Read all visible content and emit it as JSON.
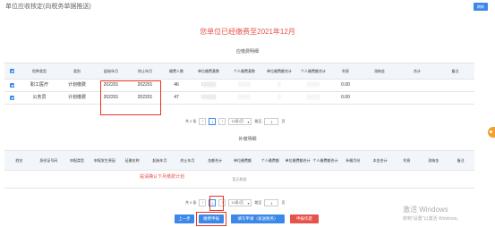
{
  "header": {
    "title": "单位应收核定(向税务单据推送)",
    "action_button": "刷新"
  },
  "banner": {
    "text": "您单位已经缴费至2021年12月"
  },
  "main_table": {
    "section_title": "应缴费明细",
    "columns": [
      "",
      "险种类型",
      "类别",
      "起始年月",
      "终止年月",
      "缴费人数",
      "单位缴费基数",
      "个人缴费基数",
      "单位缴费额合计",
      "个人缴费额合计",
      "利息",
      "滞纳金",
      "合计",
      "备注"
    ],
    "rows": [
      {
        "checked": true,
        "cells": [
          "职工医疗",
          "计划缴费",
          "202201",
          "202201",
          "46",
          "1▒▒▒▒",
          "▒▒▒▒",
          "▒",
          "▒▒▒▒",
          "0.00",
          "",
          "",
          ""
        ]
      },
      {
        "checked": true,
        "cells": [
          "公务员",
          "计划缴费",
          "202201",
          "202201",
          "47",
          "1▒▒▒▒",
          "▒▒▒▒",
          "▒",
          "▒▒▒▒",
          "0.00",
          "",
          "",
          ""
        ]
      }
    ]
  },
  "pager1": {
    "total": "共 2 条",
    "page": "1",
    "page_size": "10条/页",
    "goto_label": "跳至",
    "goto_value": "1",
    "page_unit": "页",
    "prev": "‹",
    "next": "›"
  },
  "sub_table": {
    "section_title": "补缴明细",
    "columns": [
      "姓名",
      "身份证号码",
      "申报类型",
      "申报发生原因",
      "征缴名称",
      "起始年月",
      "终止年月",
      "金额合计",
      "单位缴费额",
      "个人缴费额",
      "单位缴费额合计",
      "个人缴费额合计",
      "补缴月份",
      "本金合计",
      "利息",
      "滞纳金",
      "备注"
    ],
    "empty_text": "暂无数据"
  },
  "hint": {
    "text": "提请确认下月缴费计划"
  },
  "pager2": {
    "total": "共 0 条",
    "page": "1",
    "page_size": "10条/页",
    "goto_label": "跳至",
    "goto_value": "1",
    "page_unit": "页",
    "prev": "‹",
    "next": "›"
  },
  "buttons": {
    "prev": "上一步",
    "pay": "缴费申报",
    "fill": "填写申请（发送税务）",
    "void": "申报作废"
  },
  "watermark": {
    "line1": "激活 Windows",
    "line2": "转到\"设置\"以激活 Windows。"
  },
  "colors": {
    "accent": "#3b88e8",
    "alert": "#e5534b",
    "header_bg": "#f2f5fa"
  }
}
